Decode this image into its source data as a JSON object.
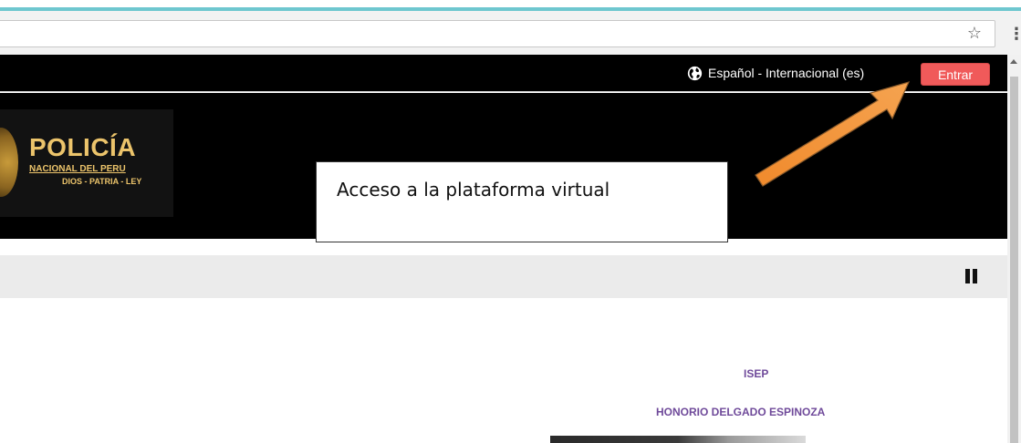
{
  "browser": {
    "star_glyph": "☆",
    "menu_glyph": "⋮"
  },
  "topbar": {
    "language_label": "Español - Internacional (es)",
    "login_label": "Entrar"
  },
  "logo": {
    "title": "POLICÍA",
    "line1": "NACIONAL DEL PERU",
    "line2": "DIOS - PATRIA - LEY"
  },
  "annotation": {
    "callout_text": "Acceso a la plataforma virtual",
    "arrow_color": "#f08a2c"
  },
  "content": {
    "isep_label": "ISEP",
    "school_name": "HONORIO DELGADO ESPINOZA"
  },
  "colors": {
    "login_button": "#f05a5a",
    "accent_text": "#6f4a9a",
    "browser_strip": "#6ec7cf"
  }
}
